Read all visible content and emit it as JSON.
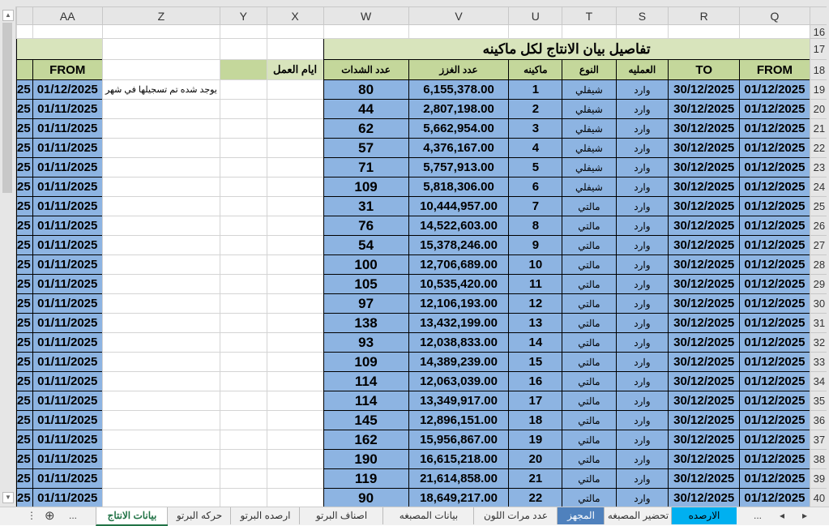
{
  "columns": [
    "Q",
    "R",
    "S",
    "T",
    "U",
    "V",
    "W",
    "X",
    "Y",
    "Z",
    "AA"
  ],
  "row_numbers_top": [
    "16",
    "17",
    "18"
  ],
  "title": "تفاصيل بيان الانتاج لكل ماكينه",
  "headers": {
    "Q": "FROM",
    "R": "TO",
    "S": "العمليه",
    "T": "النوع",
    "U": "ماكينه",
    "V": "عدد الغزز",
    "W": "عدد الشدات",
    "X": "ايام العمل",
    "AA": "FROM"
  },
  "note": "يوجد شده تم تسجيلها في شهر",
  "partial_value": "25",
  "rows": [
    {
      "n": "19",
      "from": "01/12/2025",
      "to": "30/12/2025",
      "op": "وارد",
      "type": "شيفلي",
      "machine": "1",
      "yarn": "6,155,378.00",
      "count": "80",
      "aa": "01/12/2025"
    },
    {
      "n": "20",
      "from": "01/12/2025",
      "to": "30/12/2025",
      "op": "وارد",
      "type": "شيفلي",
      "machine": "2",
      "yarn": "2,807,198.00",
      "count": "44",
      "aa": "01/11/2025"
    },
    {
      "n": "21",
      "from": "01/12/2025",
      "to": "30/12/2025",
      "op": "وارد",
      "type": "شيفلي",
      "machine": "3",
      "yarn": "5,662,954.00",
      "count": "62",
      "aa": "01/11/2025"
    },
    {
      "n": "22",
      "from": "01/12/2025",
      "to": "30/12/2025",
      "op": "وارد",
      "type": "شيفلي",
      "machine": "4",
      "yarn": "4,376,167.00",
      "count": "57",
      "aa": "01/11/2025"
    },
    {
      "n": "23",
      "from": "01/12/2025",
      "to": "30/12/2025",
      "op": "وارد",
      "type": "شيفلي",
      "machine": "5",
      "yarn": "5,757,913.00",
      "count": "71",
      "aa": "01/11/2025"
    },
    {
      "n": "24",
      "from": "01/12/2025",
      "to": "30/12/2025",
      "op": "وارد",
      "type": "شيفلي",
      "machine": "6",
      "yarn": "5,818,306.00",
      "count": "109",
      "aa": "01/11/2025"
    },
    {
      "n": "25",
      "from": "01/12/2025",
      "to": "30/12/2025",
      "op": "وارد",
      "type": "مالتي",
      "machine": "7",
      "yarn": "10,444,957.00",
      "count": "31",
      "aa": "01/11/2025"
    },
    {
      "n": "26",
      "from": "01/12/2025",
      "to": "30/12/2025",
      "op": "وارد",
      "type": "مالتي",
      "machine": "8",
      "yarn": "14,522,603.00",
      "count": "76",
      "aa": "01/11/2025"
    },
    {
      "n": "27",
      "from": "01/12/2025",
      "to": "30/12/2025",
      "op": "وارد",
      "type": "مالتي",
      "machine": "9",
      "yarn": "15,378,246.00",
      "count": "54",
      "aa": "01/11/2025"
    },
    {
      "n": "28",
      "from": "01/12/2025",
      "to": "30/12/2025",
      "op": "وارد",
      "type": "مالتي",
      "machine": "10",
      "yarn": "12,706,689.00",
      "count": "100",
      "aa": "01/11/2025"
    },
    {
      "n": "29",
      "from": "01/12/2025",
      "to": "30/12/2025",
      "op": "وارد",
      "type": "مالتي",
      "machine": "11",
      "yarn": "10,535,420.00",
      "count": "105",
      "aa": "01/11/2025"
    },
    {
      "n": "30",
      "from": "01/12/2025",
      "to": "30/12/2025",
      "op": "وارد",
      "type": "مالتي",
      "machine": "12",
      "yarn": "12,106,193.00",
      "count": "97",
      "aa": "01/11/2025"
    },
    {
      "n": "31",
      "from": "01/12/2025",
      "to": "30/12/2025",
      "op": "وارد",
      "type": "مالتي",
      "machine": "13",
      "yarn": "13,432,199.00",
      "count": "138",
      "aa": "01/11/2025"
    },
    {
      "n": "32",
      "from": "01/12/2025",
      "to": "30/12/2025",
      "op": "وارد",
      "type": "مالتي",
      "machine": "14",
      "yarn": "12,038,833.00",
      "count": "93",
      "aa": "01/11/2025"
    },
    {
      "n": "33",
      "from": "01/12/2025",
      "to": "30/12/2025",
      "op": "وارد",
      "type": "مالتي",
      "machine": "15",
      "yarn": "14,389,239.00",
      "count": "109",
      "aa": "01/11/2025"
    },
    {
      "n": "34",
      "from": "01/12/2025",
      "to": "30/12/2025",
      "op": "وارد",
      "type": "مالتي",
      "machine": "16",
      "yarn": "12,063,039.00",
      "count": "114",
      "aa": "01/11/2025"
    },
    {
      "n": "35",
      "from": "01/12/2025",
      "to": "30/12/2025",
      "op": "وارد",
      "type": "مالتي",
      "machine": "17",
      "yarn": "13,349,917.00",
      "count": "114",
      "aa": "01/11/2025"
    },
    {
      "n": "36",
      "from": "01/12/2025",
      "to": "30/12/2025",
      "op": "وارد",
      "type": "مالتي",
      "machine": "18",
      "yarn": "12,896,151.00",
      "count": "145",
      "aa": "01/11/2025"
    },
    {
      "n": "37",
      "from": "01/12/2025",
      "to": "30/12/2025",
      "op": "وارد",
      "type": "مالتي",
      "machine": "19",
      "yarn": "15,956,867.00",
      "count": "162",
      "aa": "01/11/2025"
    },
    {
      "n": "38",
      "from": "01/12/2025",
      "to": "30/12/2025",
      "op": "وارد",
      "type": "مالتي",
      "machine": "20",
      "yarn": "16,615,218.00",
      "count": "190",
      "aa": "01/11/2025"
    },
    {
      "n": "39",
      "from": "01/12/2025",
      "to": "30/12/2025",
      "op": "وارد",
      "type": "مالتي",
      "machine": "21",
      "yarn": "21,614,858.00",
      "count": "119",
      "aa": "01/11/2025"
    },
    {
      "n": "40",
      "from": "01/12/2025",
      "to": "30/12/2025",
      "op": "وارد",
      "type": "مالتي",
      "machine": "22",
      "yarn": "18,649,217.00",
      "count": "90",
      "aa": "01/11/2025"
    }
  ],
  "tabs": [
    "بيانات الانتاج",
    "حركه البرتو",
    "ارصده البرتو",
    "اصناف البرتو",
    "بيانات المصبغه",
    "عدد مرات اللون",
    "المجهز",
    "تحضير المصبغه",
    "الارصده"
  ],
  "tab_nav": {
    "more": "...",
    "add": "+",
    "prev": "◂",
    "next": "▸"
  }
}
